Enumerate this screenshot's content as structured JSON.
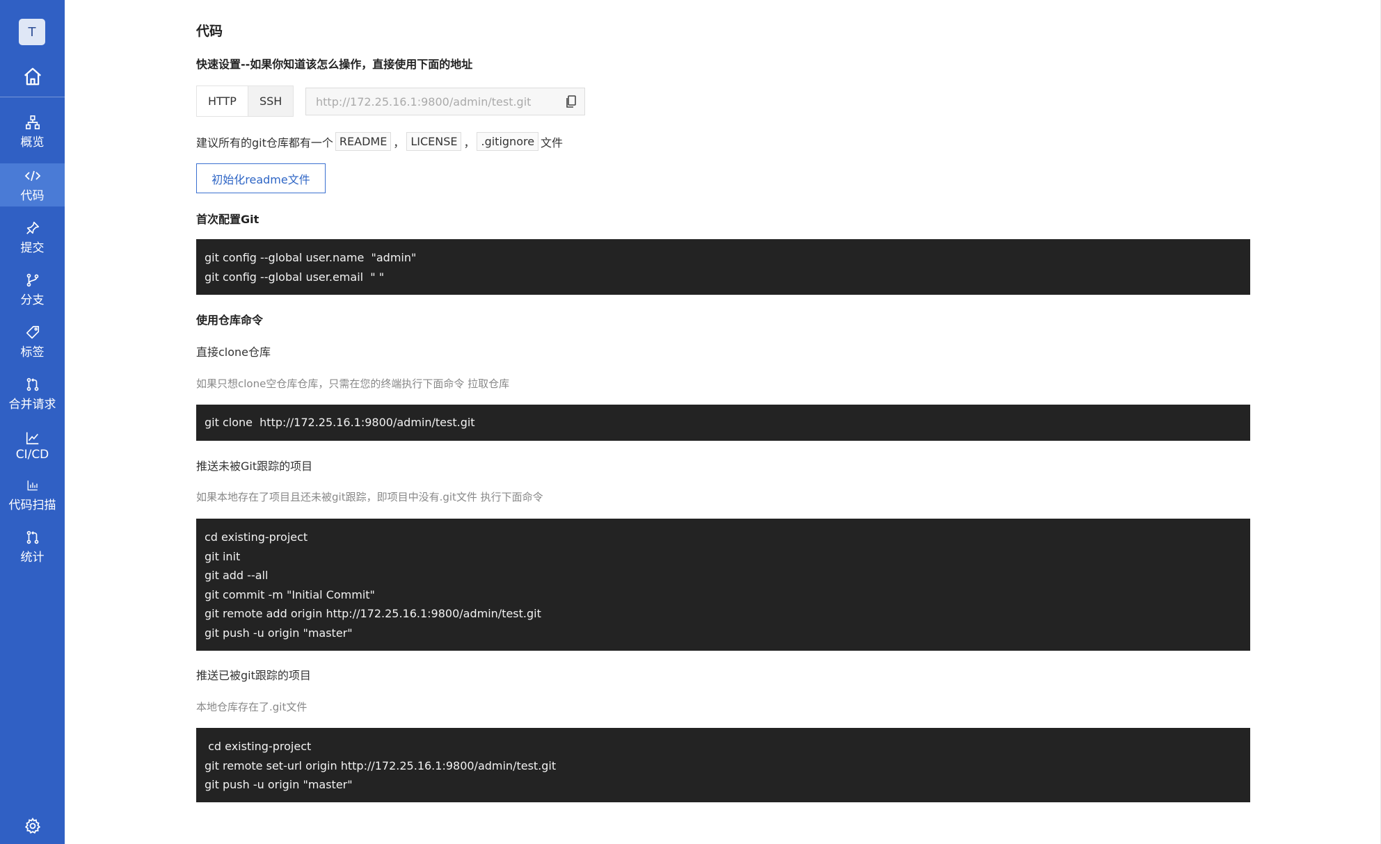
{
  "sidebar": {
    "avatar_letter": "T",
    "home_icon": "home-icon",
    "items": [
      {
        "label": "概览",
        "icon": "sitemap-icon",
        "active": false
      },
      {
        "label": "代码",
        "icon": "code-icon",
        "active": true
      },
      {
        "label": "提交",
        "icon": "pin-icon",
        "active": false
      },
      {
        "label": "分支",
        "icon": "branch-icon",
        "active": false
      },
      {
        "label": "标签",
        "icon": "tag-icon",
        "active": false
      },
      {
        "label": "合并请求",
        "icon": "merge-request-icon",
        "active": false
      },
      {
        "label": "CI/CD",
        "icon": "chart-line-icon",
        "active": false
      },
      {
        "label": "代码扫描",
        "icon": "bar-chart-icon",
        "active": false
      },
      {
        "label": "统计",
        "icon": "merge-request-icon",
        "active": false
      }
    ],
    "settings_icon": "gear-icon",
    "colors": {
      "background": "#3060c4",
      "active": "#4a7bd6"
    }
  },
  "page": {
    "title": "代码",
    "quick_setup_title": "快速设置--如果你知道该怎么操作，直接使用下面的地址",
    "protocols": [
      "HTTP",
      "SSH"
    ],
    "repo_url": "http://172.25.16.1:9800/admin/test.git",
    "recommend_prefix": "建议所有的git仓库都有一个",
    "recommend_files": [
      "README",
      "LICENSE",
      ".gitignore"
    ],
    "recommend_sep": "，",
    "recommend_suffix": "文件",
    "init_readme_button": "初始化readme文件",
    "first_config_title": "首次配置Git",
    "first_config_code": "git config --global user.name  \"admin\"\ngit config --global user.email  \" \"",
    "use_repo_title": "使用仓库命令",
    "clone_title": "直接clone仓库",
    "clone_desc": "如果只想clone空仓库仓库，只需在您的终端执行下面命令 拉取仓库",
    "clone_code": "git clone  http://172.25.16.1:9800/admin/test.git",
    "push_untracked_title": "推送未被Git跟踪的项目",
    "push_untracked_desc": "如果本地存在了项目且还未被git跟踪，即项目中没有.git文件 执行下面命令",
    "push_untracked_code": "cd existing-project\ngit init\ngit add --all\ngit commit -m \"Initial Commit\"\ngit remote add origin http://172.25.16.1:9800/admin/test.git\ngit push -u origin \"master\"",
    "push_tracked_title": "推送已被git跟踪的项目",
    "push_tracked_desc": "本地仓库存在了.git文件",
    "push_tracked_code": " cd existing-project\ngit remote set-url origin http://172.25.16.1:9800/admin/test.git\ngit push -u origin \"master\"",
    "accent_color": "#2e65c5",
    "code_bg": "#232323"
  }
}
